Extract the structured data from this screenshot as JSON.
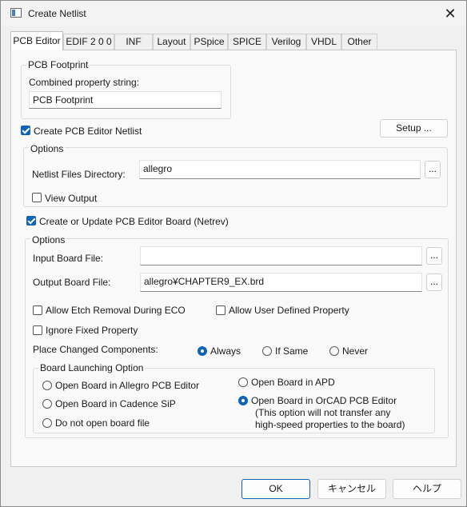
{
  "window": {
    "title": "Create Netlist",
    "close_symbol": "✕"
  },
  "tabs": [
    "PCB Editor",
    "EDIF 2 0 0",
    "INF",
    "Layout",
    "PSpice",
    "SPICE",
    "Verilog",
    "VHDL",
    "Other"
  ],
  "pcb_footprint": {
    "legend": "PCB Footprint",
    "combined_label": "Combined property string:",
    "combined_value": "PCB Footprint"
  },
  "create_netlist": {
    "label": "Create PCB Editor Netlist",
    "checked": true
  },
  "setup_button": "Setup ...",
  "options1": {
    "legend": "Options",
    "dir_label": "Netlist Files Directory:",
    "dir_value": "allegro",
    "browse": "...",
    "view_output": {
      "label": "View Output",
      "checked": false
    }
  },
  "update_board": {
    "label": "Create or Update PCB Editor Board (Netrev)",
    "checked": true
  },
  "options2": {
    "legend": "Options",
    "input_label": "Input Board File:",
    "input_value": "",
    "output_label": "Output Board File:",
    "output_value": "allegro¥CHAPTER9_EX.brd",
    "browse": "...",
    "allow_etch": {
      "label": "Allow Etch Removal During ECO",
      "checked": false
    },
    "allow_user": {
      "label": "Allow User Defined Property",
      "checked": false
    },
    "ignore_fixed": {
      "label": "Ignore Fixed Property",
      "checked": false
    },
    "place_changed_label": "Place Changed Components:",
    "place_options": [
      "Always",
      "If Same",
      "Never"
    ],
    "place_selected": "Always"
  },
  "launch": {
    "legend": "Board Launching Option",
    "left_options": [
      "Open Board in Allegro PCB Editor",
      "Open Board in Cadence SiP",
      "Do not open board file"
    ],
    "right_options": [
      "Open Board in APD",
      "Open Board in OrCAD PCB Editor"
    ],
    "note_line1": "(This option will not transfer any",
    "note_line2": "high-speed properties to the board)",
    "selected": "Open Board in OrCAD PCB Editor"
  },
  "footer": {
    "ok": "OK",
    "cancel": "キャンセル",
    "help": "ヘルプ"
  },
  "colors": {
    "accent": "#1063b5"
  }
}
